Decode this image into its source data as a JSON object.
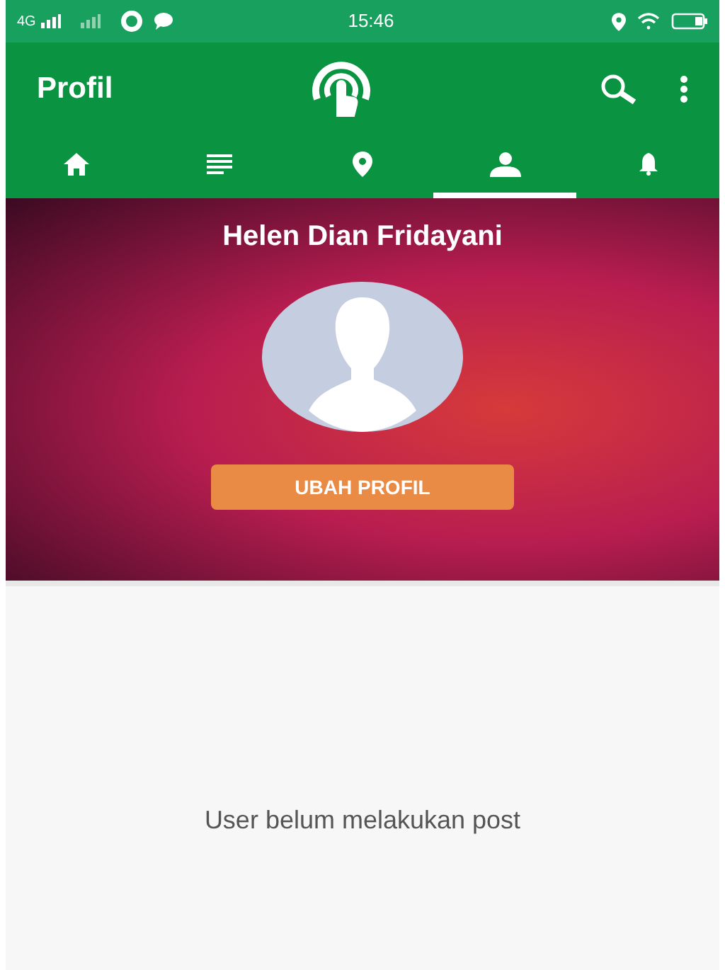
{
  "status_bar": {
    "network": "4G",
    "time": "15:46"
  },
  "app_bar": {
    "title": "Profil"
  },
  "tabs": [
    {
      "kind": "home",
      "selected": false
    },
    {
      "kind": "list",
      "selected": false
    },
    {
      "kind": "location",
      "selected": false
    },
    {
      "kind": "person",
      "selected": true
    },
    {
      "kind": "bell",
      "selected": false
    }
  ],
  "profile": {
    "name": "Helen Dian Fridayani",
    "button": "UBAH PROFIL"
  },
  "empty_message": "User belum melakukan post"
}
